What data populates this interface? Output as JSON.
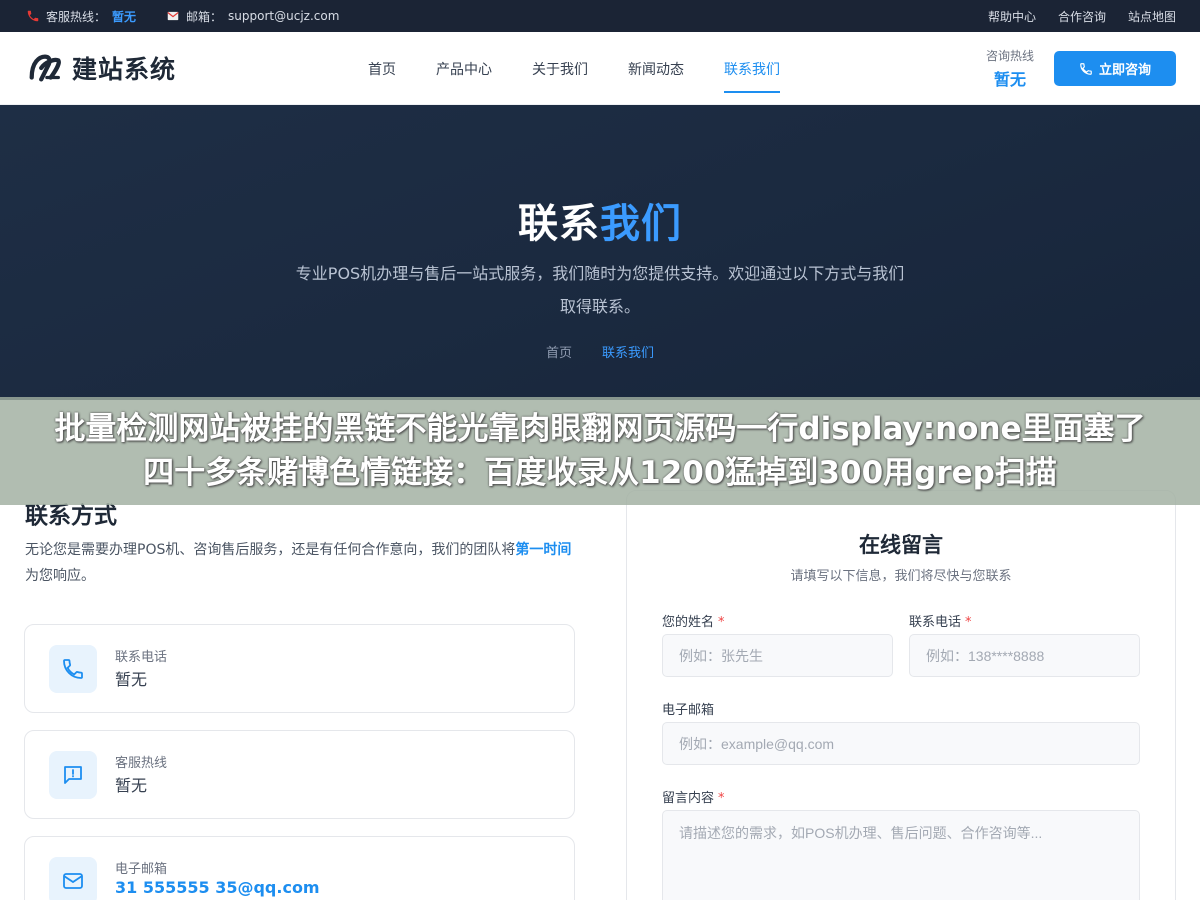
{
  "topbar": {
    "hotline_label": "客服热线：",
    "hotline_value": "暂无",
    "email_label": "邮箱：",
    "email_value": "support@ucjz.com",
    "links": [
      "帮助中心",
      "合作咨询",
      "站点地图"
    ]
  },
  "header": {
    "logo_text": "建站系统",
    "nav": [
      "首页",
      "产品中心",
      "关于我们",
      "新闻动态",
      "联系我们"
    ],
    "nav_active_index": 4,
    "hotline_label": "咨询热线",
    "hotline_value": "暂无",
    "consult_button": "立即咨询"
  },
  "hero": {
    "title_part1": "联系",
    "title_part2": "我们",
    "description": "专业POS机办理与售后一站式服务，我们随时为您提供支持。欢迎通过以下方式与我们取得联系。",
    "breadcrumb_home": "首页",
    "breadcrumb_current": "联系我们"
  },
  "overlay": {
    "text": "批量检测网站被挂的黑链不能光靠肉眼翻网页源码一行display:none里面塞了四十多条赌博色情链接：百度收录从1200猛掉到300用grep扫描"
  },
  "contact": {
    "title": "联系方式",
    "desc_part1": "无论您是需要办理POS机、咨询售后服务，还是有任何合作意向，我们的团队将",
    "desc_highlight": "第一时间",
    "desc_part2": "为您响应。",
    "cards": [
      {
        "label": "联系电话",
        "value": "暂无",
        "icon": "phone-icon"
      },
      {
        "label": "客服热线",
        "value": "暂无",
        "icon": "chat-icon"
      },
      {
        "label": "电子邮箱",
        "value": "31 555555 35@qq.com",
        "icon": "mail-icon"
      }
    ]
  },
  "form": {
    "title": "在线留言",
    "subtitle": "请填写以下信息，我们将尽快与您联系",
    "name_label": "您的姓名",
    "name_placeholder": "例如：张先生",
    "phone_label": "联系电话",
    "phone_placeholder": "例如：138****8888",
    "email_label": "电子邮箱",
    "email_placeholder": "例如：example@qq.com",
    "message_label": "留言内容",
    "message_placeholder": "请描述您的需求，如POS机办理、售后问题、合作咨询等...",
    "required_mark": "*"
  },
  "colors": {
    "accent": "#1d8ef0",
    "topbar_bg": "#1b2435",
    "hero_bg": "#1e2e45",
    "required": "#ef4444"
  }
}
